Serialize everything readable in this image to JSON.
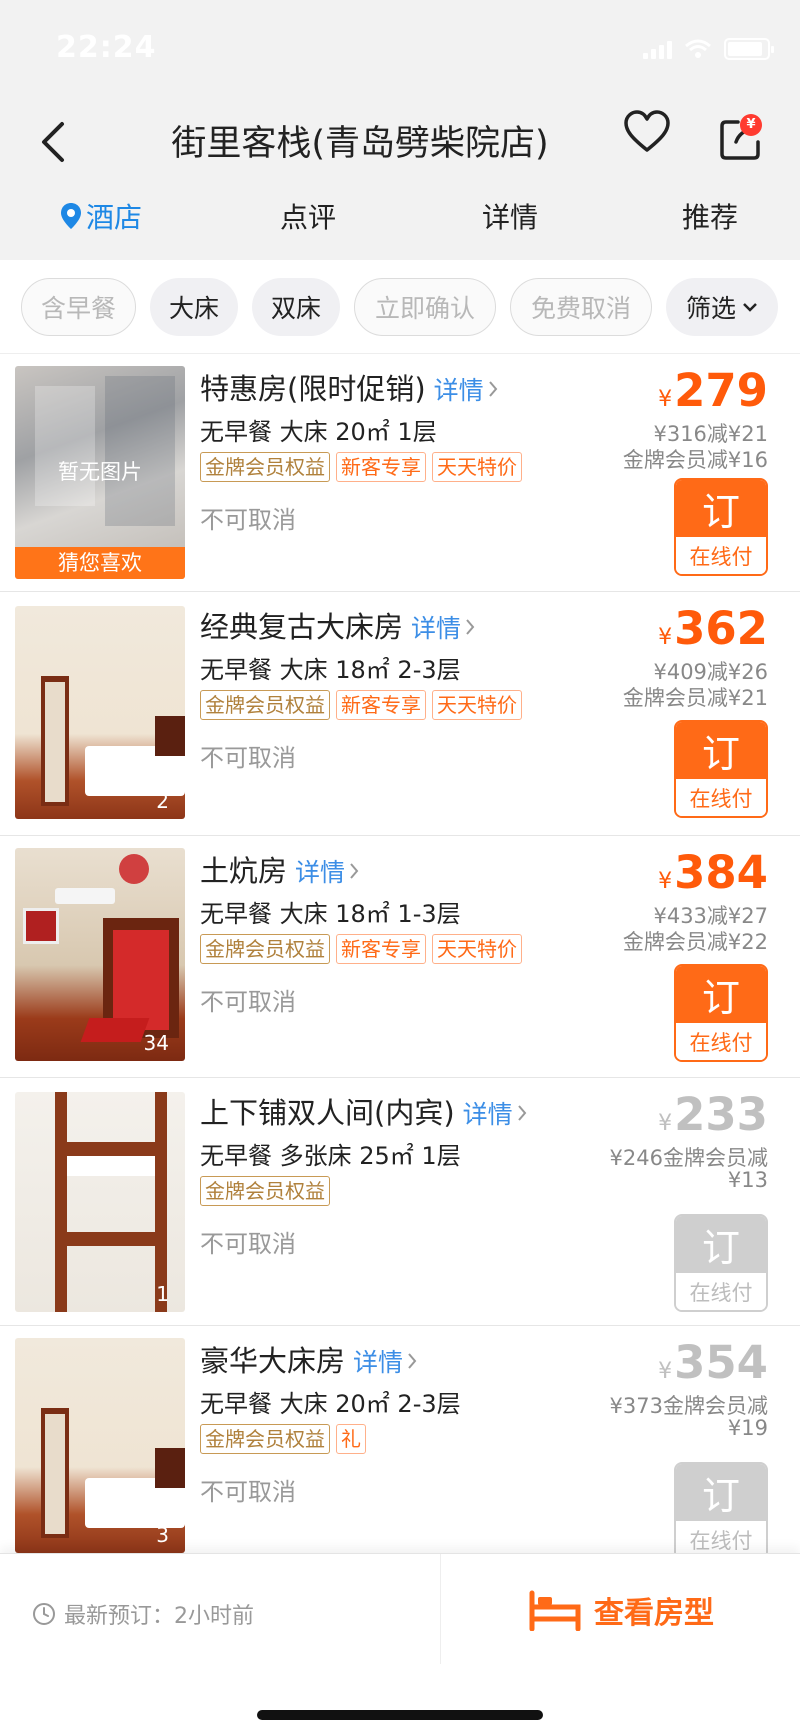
{
  "status_bar": {
    "time": "22:24"
  },
  "header": {
    "title": "街里客栈(青岛劈柴院店)",
    "share_badge": "¥"
  },
  "tabs": [
    {
      "label": "酒店",
      "active": true
    },
    {
      "label": "点评",
      "active": false
    },
    {
      "label": "详情",
      "active": false
    },
    {
      "label": "推荐",
      "active": false
    }
  ],
  "filters": [
    {
      "label": "含早餐",
      "disabled": true
    },
    {
      "label": "大床",
      "disabled": false
    },
    {
      "label": "双床",
      "disabled": false
    },
    {
      "label": "立即确认",
      "disabled": true
    },
    {
      "label": "免费取消",
      "disabled": true
    },
    {
      "label": "筛选",
      "disabled": false
    }
  ],
  "rooms": [
    {
      "name": "特惠房(限时促销)",
      "detail": "详情",
      "specs": "无早餐 大床   20㎡  1层",
      "tags": [
        "金牌会员权益",
        "新客专享",
        "天天特价"
      ],
      "cancel": "不可取消",
      "currency": "¥",
      "price": "279",
      "sub1": "¥316减¥21",
      "sub2": "金牌会员减¥16",
      "book": "订",
      "pay": "在线付",
      "available": true,
      "photo_count": "",
      "no_image": "暂无图片",
      "banner": "猜您喜欢"
    },
    {
      "name": "经典复古大床房",
      "detail": "详情",
      "specs": "无早餐 大床   18㎡  2-3层",
      "tags": [
        "金牌会员权益",
        "新客专享",
        "天天特价"
      ],
      "cancel": "不可取消",
      "currency": "¥",
      "price": "362",
      "sub1": "¥409减¥26",
      "sub2": "金牌会员减¥21",
      "book": "订",
      "pay": "在线付",
      "available": true,
      "photo_count": "2"
    },
    {
      "name": "土炕房",
      "detail": "详情",
      "specs": "无早餐 大床   18㎡  1-3层",
      "tags": [
        "金牌会员权益",
        "新客专享",
        "天天特价"
      ],
      "cancel": "不可取消",
      "currency": "¥",
      "price": "384",
      "sub1": "¥433减¥27",
      "sub2": "金牌会员减¥22",
      "book": "订",
      "pay": "在线付",
      "available": true,
      "photo_count": "34"
    },
    {
      "name": "上下铺双人间(内宾)",
      "detail": "详情",
      "specs": "无早餐 多张床   25㎡  1层",
      "tags": [
        "金牌会员权益"
      ],
      "cancel": "不可取消",
      "currency": "¥",
      "price": "233",
      "sub1": "¥246金牌会员减",
      "sub2": "¥13",
      "book": "订",
      "pay": "在线付",
      "available": false,
      "photo_count": "1"
    },
    {
      "name": "豪华大床房",
      "detail": "详情",
      "specs": "无早餐 大床   20㎡  2-3层",
      "tags": [
        "金牌会员权益",
        "礼"
      ],
      "cancel": "不可取消",
      "currency": "¥",
      "price": "354",
      "sub1": "¥373金牌会员减",
      "sub2": "¥19",
      "book": "订",
      "pay": "在线付",
      "available": false,
      "photo_count": "3"
    }
  ],
  "bottom_bar": {
    "recent_booking": "最新预订：2小时前",
    "view_room_types": "查看房型"
  },
  "colors": {
    "accent": "#ff6a17",
    "price": "#ff5a0a",
    "link": "#3c8ee6",
    "gold": "#b0813c"
  }
}
